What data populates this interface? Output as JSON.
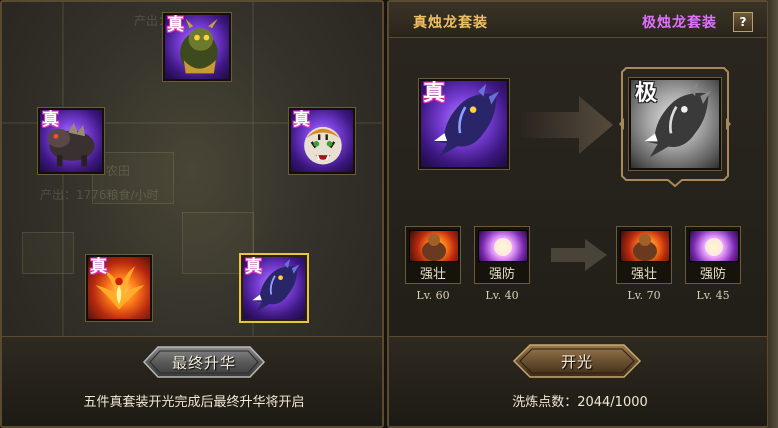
{
  "left_panel": {
    "bg_map_text": {
      "top": "产出：1776/时",
      "mid": "农田",
      "lower": "产出：1776粮食/小时"
    },
    "suits": [
      {
        "tag": "真",
        "icon": "green-dragon-beast-icon"
      },
      {
        "tag": "真",
        "icon": "armored-beast-icon"
      },
      {
        "tag": "真",
        "icon": "tiger-icon"
      },
      {
        "tag": "真",
        "icon": "phoenix-icon"
      },
      {
        "tag": "真",
        "icon": "purple-dragon-icon"
      }
    ],
    "final_button_label": "最终升华",
    "hint": "五件真套装开光完成后最终升华将开启"
  },
  "right_panel": {
    "title_left": "真烛龙套装",
    "title_right": "极烛龙套装",
    "help_label": "?",
    "source_item": {
      "tag": "真",
      "icon": "purple-dragon-icon"
    },
    "target_item": {
      "tag": "极",
      "icon": "gray-dragon-icon"
    },
    "skills_before": [
      {
        "name": "强壮",
        "level": "Lv. 60",
        "icon": "strong-warrior-icon"
      },
      {
        "name": "强防",
        "level": "Lv. 40",
        "icon": "defense-orb-icon"
      }
    ],
    "skills_after": [
      {
        "name": "强壮",
        "level": "Lv. 70",
        "icon": "strong-warrior-icon"
      },
      {
        "name": "强防",
        "level": "Lv. 45",
        "icon": "defense-orb-icon"
      }
    ],
    "open_button_label": "开光",
    "points_label": "洗炼点数：",
    "points_value": "2044/1000"
  },
  "colors": {
    "accent_gold": "#f0c060",
    "accent_purple": "#e070ff",
    "selected_border": "#e8c640"
  }
}
